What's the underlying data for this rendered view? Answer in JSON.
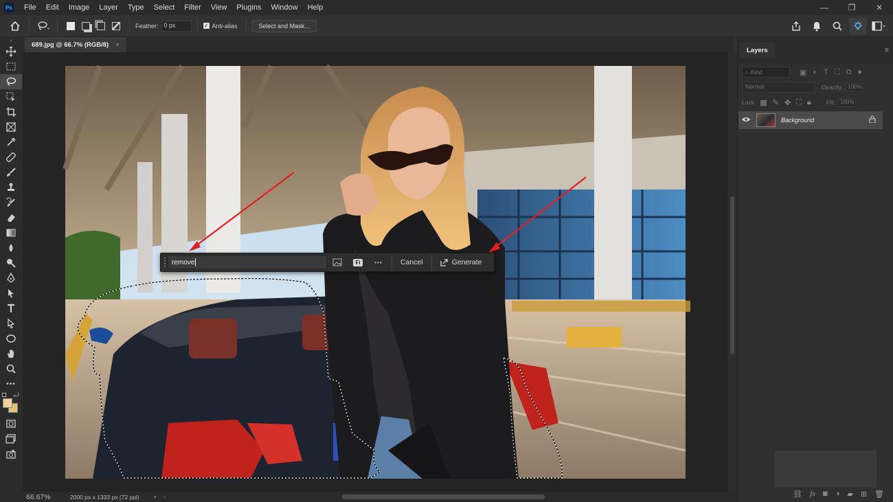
{
  "app": {
    "logo": "Ps"
  },
  "menu": [
    "File",
    "Edit",
    "Image",
    "Layer",
    "Type",
    "Select",
    "Filter",
    "View",
    "Plugins",
    "Window",
    "Help"
  ],
  "window_controls": {
    "minimize": "—",
    "restore": "❐",
    "close": "✕"
  },
  "options": {
    "feather_label": "Feather:",
    "feather_value": "0 px",
    "antialias_label": "Anti-alias",
    "select_mask_label": "Select and Mask..."
  },
  "document": {
    "tab_title": "689.jpg @ 66.7% (RGB/8)",
    "tab_close": "×"
  },
  "status": {
    "zoom": "66.67%",
    "info": "2000 px x 1333 px (72 ppi)",
    "arrow": "›"
  },
  "layers_panel": {
    "tab_label": "Layers",
    "kind_placeholder": "Kind",
    "blend_mode": "Normal",
    "opacity_label": "Opacity:",
    "opacity_value": "100%",
    "lock_label": "Lock:",
    "fill_label": "Fill:",
    "fill_value": "100%",
    "layers": [
      {
        "name": "Background",
        "visible": true,
        "locked": true
      }
    ]
  },
  "contextual_bar": {
    "prompt_value": "remove",
    "cancel_label": "Cancel",
    "generate_label": "Generate",
    "firefly_label": "Fi",
    "more_label": "•••"
  },
  "colors": {
    "accent": "#31a8ff",
    "arrow": "#e02020",
    "foreground_swatch": "#f0d29a",
    "background_swatch": "#e8c07e"
  }
}
